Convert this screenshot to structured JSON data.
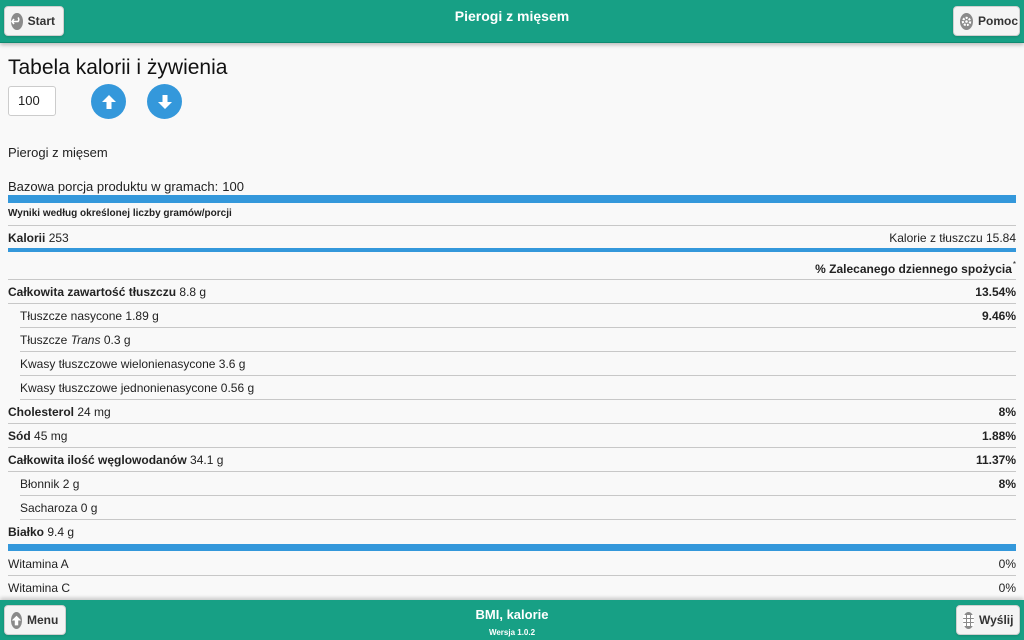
{
  "header": {
    "title": "Pierogi z mięsem",
    "start_label": "Start",
    "help_label": "Pomoc"
  },
  "main": {
    "heading": "Tabela kalorii i żywienia",
    "grams_value": "100",
    "product_name": "Pierogi z mięsem",
    "base_label": "Bazowa porcja produktu w gramach:",
    "base_value": "100",
    "results_label": "Wyniki według określonej liczby gramów/porcji",
    "calories_label": "Kalorii",
    "calories_value": "253",
    "fat_calories_label": "Kalorie z tłuszczu",
    "fat_calories_value": "15.84",
    "dv_header": "% Zalecanego dziennego spożycia",
    "dv_marker": "*",
    "nutrients": [
      {
        "name": "Całkowita zawartość tłuszczu",
        "value": "8.8 g",
        "pct": "13.54%"
      },
      {
        "name": "Tłuszcze nasycone",
        "value": "1.89 g",
        "pct": "9.46%"
      },
      {
        "name": "Tłuszcze",
        "name_em": "Trans",
        "value": "0.3 g",
        "pct": ""
      },
      {
        "name": "Kwasy tłuszczowe wielonienasycone",
        "value": "3.6 g",
        "pct": ""
      },
      {
        "name": "Kwasy tłuszczowe jednonienasycone",
        "value": "0.56 g",
        "pct": ""
      },
      {
        "name": "Cholesterol",
        "value": "24 mg",
        "pct": "8%"
      },
      {
        "name": "Sód",
        "value": "45 mg",
        "pct": "1.88%"
      },
      {
        "name": "Całkowita ilość węglowodanów",
        "value": "34.1 g",
        "pct": "11.37%"
      },
      {
        "name": "Błonnik",
        "value": "2 g",
        "pct": "8%"
      },
      {
        "name": "Sacharoza",
        "value": "0 g",
        "pct": ""
      },
      {
        "name": "Białko",
        "value": "9.4 g",
        "pct": ""
      }
    ],
    "vitamins": [
      {
        "name": "Witamina A",
        "pct": "0%"
      },
      {
        "name": "Witamina C",
        "pct": "0%"
      }
    ]
  },
  "footer": {
    "title": "BMI, kalorie",
    "version": "Wersja 1.0.2",
    "menu_label": "Menu",
    "send_label": "Wyślij"
  },
  "colors": {
    "bar": "#17a085",
    "accent": "#3498db"
  },
  "icons": {
    "start": "back-arrow-icon",
    "help": "gear-icon",
    "up": "arrow-up-icon",
    "down": "arrow-down-icon",
    "menu": "arrow-up-icon",
    "send": "grid-icon"
  }
}
